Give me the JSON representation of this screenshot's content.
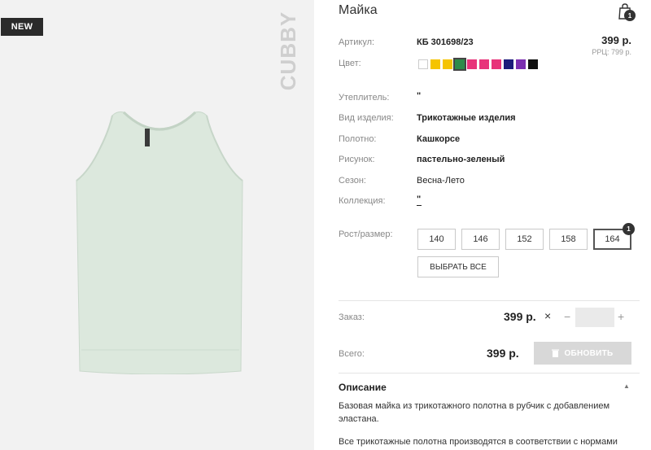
{
  "badge": {
    "new": "NEW"
  },
  "brand": "CUBBY",
  "product": {
    "title": "Майка",
    "price": "399 р.",
    "rrc": "РРЦ: 799 р."
  },
  "cart": {
    "count": "1"
  },
  "fields": {
    "article_label": "Артикул:",
    "article_value": "КБ 301698/23",
    "color_label": "Цвет:",
    "insulation_label": "Утеплитель:",
    "insulation_value": "\"",
    "type_label": "Вид изделия:",
    "type_value": "Трикотажные изделия",
    "fabric_label": "Полотно:",
    "fabric_value": "Кашкорсе",
    "pattern_label": "Рисунок:",
    "pattern_value": "пастельно-зеленый",
    "season_label": "Сезон:",
    "season_value": "Весна-Лето",
    "collection_label": "Коллекция:",
    "collection_value": "\""
  },
  "colors": [
    "#ffffff",
    "#f5c400",
    "#f5c400",
    "#2e8b4a",
    "#e8337a",
    "#e8337a",
    "#e8337a",
    "#1c1c7a",
    "#7b2fb0",
    "#111111"
  ],
  "selected_color_index": 3,
  "sizes": {
    "label": "Рост/размер:",
    "options": [
      "140",
      "146",
      "152",
      "158",
      "164"
    ],
    "active_index": 4,
    "active_count": "1",
    "select_all": "ВЫБРАТЬ ВСЕ"
  },
  "order": {
    "label": "Заказ:",
    "price": "399 р.",
    "times": "×",
    "minus": "−",
    "plus": "+",
    "quantity": ""
  },
  "total": {
    "label": "Всего:",
    "price": "399 р.",
    "update_button": "ОБНОВИТЬ"
  },
  "description": {
    "heading": "Описание",
    "toggle": "▲",
    "paragraphs": [
      "Базовая майка из трикотажного полотна в рубчик с добавлением эластана.",
      "Все трикотажные полотна производятся в соответствии с нормами"
    ]
  },
  "product_color": "#dde9df"
}
